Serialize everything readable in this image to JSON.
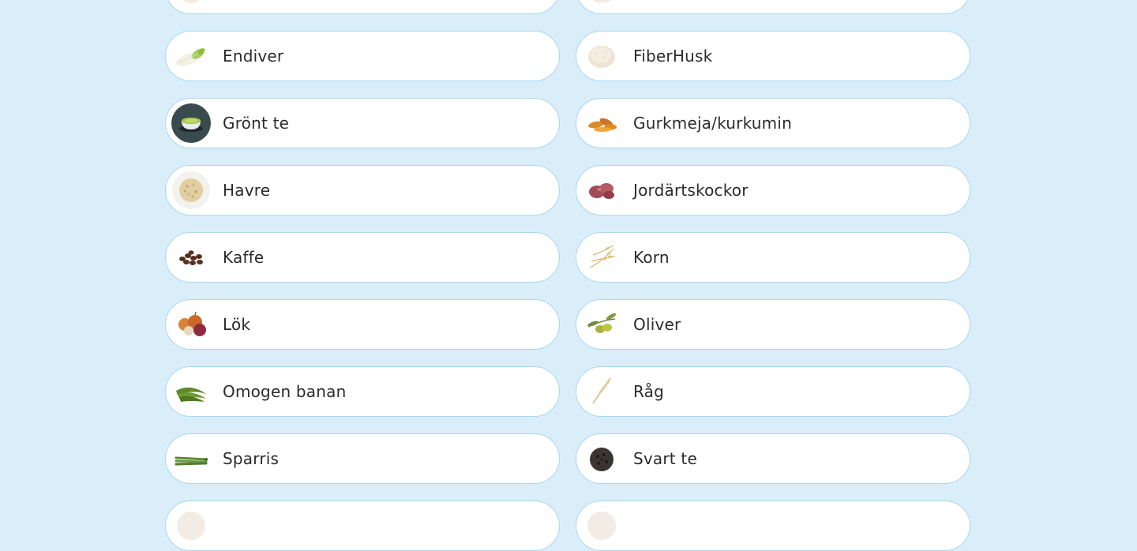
{
  "items": [
    {
      "label": "",
      "icon": "food-icon"
    },
    {
      "label": "",
      "icon": "food-icon"
    },
    {
      "label": "Endiver",
      "icon": "endive-icon"
    },
    {
      "label": "FiberHusk",
      "icon": "fiberhusk-icon"
    },
    {
      "label": "Grönt te",
      "icon": "green-tea-icon"
    },
    {
      "label": "Gurkmeja/kurkumin",
      "icon": "turmeric-icon"
    },
    {
      "label": "Havre",
      "icon": "oats-icon"
    },
    {
      "label": "Jordärtskockor",
      "icon": "jerusalem-artichoke-icon"
    },
    {
      "label": "Kaffe",
      "icon": "coffee-beans-icon"
    },
    {
      "label": "Korn",
      "icon": "barley-icon"
    },
    {
      "label": "Lök",
      "icon": "onion-icon"
    },
    {
      "label": "Oliver",
      "icon": "olives-icon"
    },
    {
      "label": "Omogen banan",
      "icon": "green-banana-icon"
    },
    {
      "label": "Råg",
      "icon": "rye-icon"
    },
    {
      "label": "Sparris",
      "icon": "asparagus-icon"
    },
    {
      "label": "Svart te",
      "icon": "black-tea-icon"
    },
    {
      "label": "",
      "icon": "food-icon"
    },
    {
      "label": "",
      "icon": "food-icon"
    }
  ]
}
